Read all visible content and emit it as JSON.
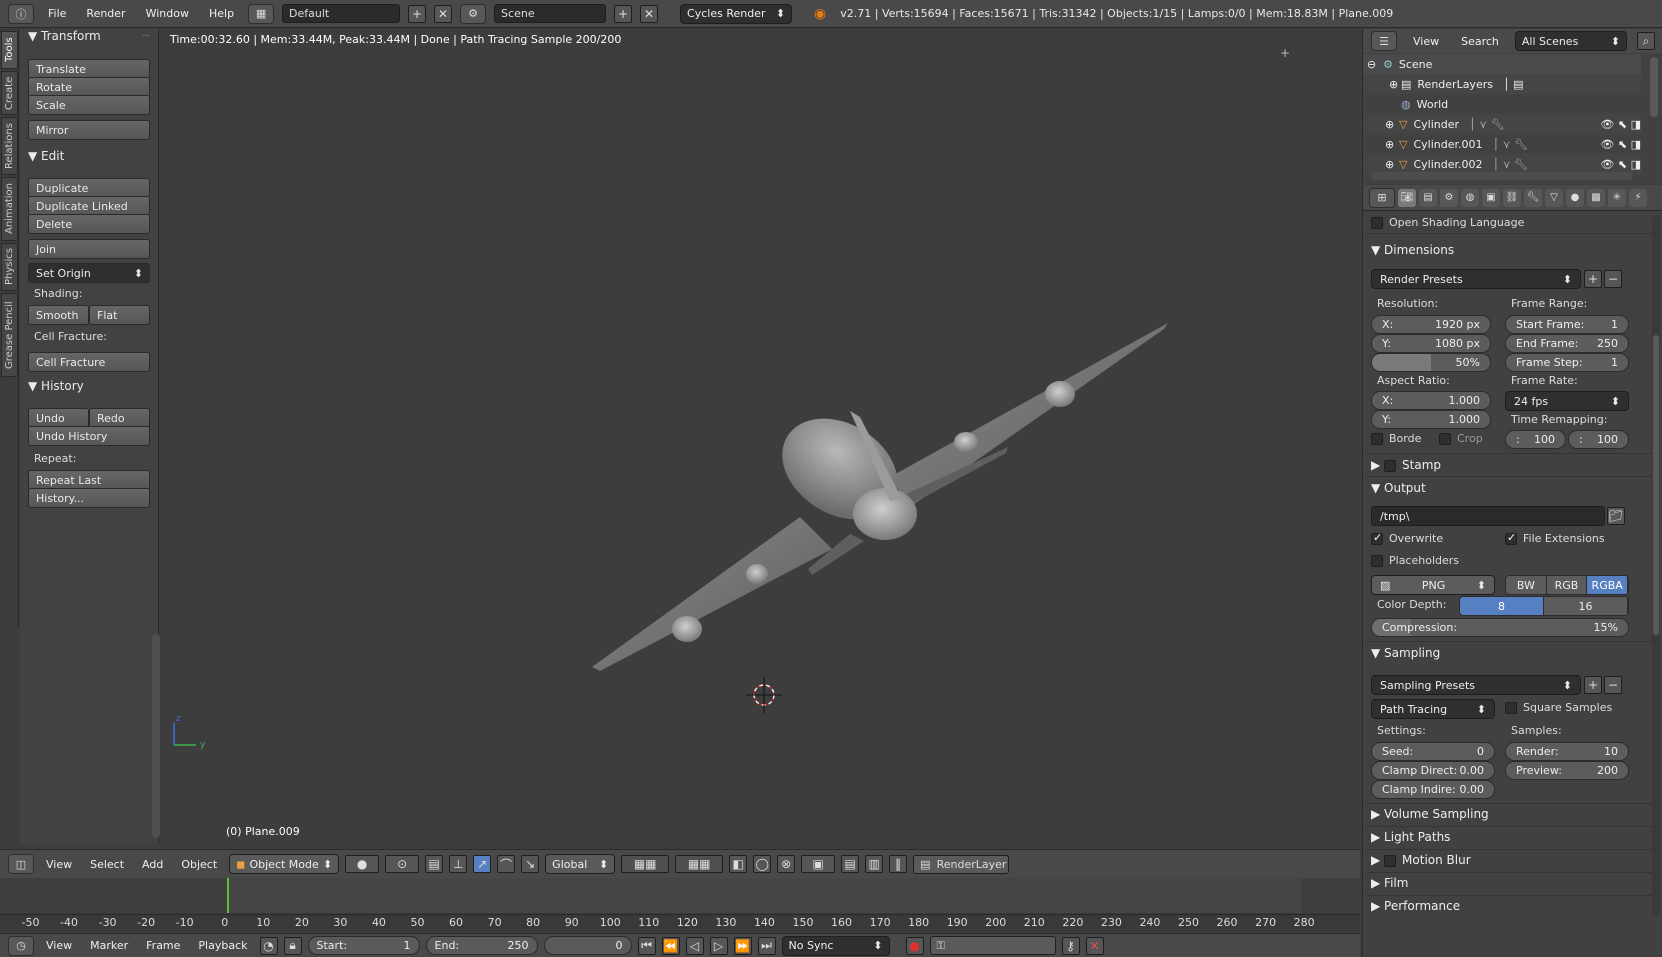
{
  "topbar": {
    "menus": [
      "File",
      "Render",
      "Window",
      "Help"
    ],
    "layout": "Default",
    "scene": "Scene",
    "engine": "Cycles Render",
    "stats": "v2.71 | Verts:15694 | Faces:15671 | Tris:31342 | Objects:1/15 | Lamps:0/0 | Mem:18.83M | Plane.009"
  },
  "lefttabs": [
    "Tools",
    "Create",
    "Relations",
    "Animation",
    "Physics",
    "Grease Pencil"
  ],
  "toolshelf": {
    "transform": {
      "title": "Transform",
      "buttons": [
        "Translate",
        "Rotate",
        "Scale",
        "Mirror"
      ]
    },
    "edit": {
      "title": "Edit",
      "buttons": [
        "Duplicate",
        "Duplicate Linked",
        "Delete",
        "Join"
      ],
      "set_origin": "Set Origin",
      "shading_label": "Shading:",
      "smooth": "Smooth",
      "flat": "Flat",
      "cell_fracture_label": "Cell Fracture:",
      "cell_fracture": "Cell Fracture"
    },
    "history": {
      "title": "History",
      "undo": "Undo",
      "redo": "Redo",
      "undo_history": "Undo History",
      "repeat_label": "Repeat:",
      "repeat_last": "Repeat Last",
      "history_btn": "History..."
    }
  },
  "viewport": {
    "info": "Time:00:32.60 | Mem:33.44M, Peak:33.44M | Done | Path Tracing Sample 200/200",
    "object_label": "(0) Plane.009",
    "axis_z": "z",
    "axis_y": "y"
  },
  "vpheader": {
    "menus": [
      "View",
      "Select",
      "Add",
      "Object"
    ],
    "mode": "Object Mode",
    "orientation": "Global",
    "render_layer": "RenderLayer"
  },
  "timeline": {
    "ticks": [
      "-50",
      "-40",
      "-30",
      "-20",
      "-10",
      "0",
      "10",
      "20",
      "30",
      "40",
      "50",
      "60",
      "70",
      "80",
      "90",
      "100",
      "110",
      "120",
      "130",
      "140",
      "150",
      "160",
      "170",
      "180",
      "190",
      "200",
      "210",
      "220",
      "230",
      "240",
      "250",
      "260",
      "270",
      "280"
    ],
    "current_frame": 0
  },
  "bottombar": {
    "menus": [
      "View",
      "Marker",
      "Frame",
      "Playback"
    ],
    "start_label": "Start:",
    "start": "1",
    "end_label": "End:",
    "end": "250",
    "current": "0",
    "sync": "No Sync"
  },
  "outliner": {
    "menus": [
      "View",
      "Search"
    ],
    "scenes": "All Scenes",
    "rows": [
      {
        "name": "Scene"
      },
      {
        "name": "RenderLayers"
      },
      {
        "name": "World"
      },
      {
        "name": "Cylinder"
      },
      {
        "name": "Cylinder.001"
      },
      {
        "name": "Cylinder.002"
      }
    ]
  },
  "props": {
    "osl": "Open Shading Language",
    "dimensions": {
      "title": "Dimensions",
      "presets": "Render Presets",
      "resolution_label": "Resolution:",
      "res_x_label": "X:",
      "res_x": "1920 px",
      "res_y_label": "Y:",
      "res_y": "1080 px",
      "res_pct": "50%",
      "aspect_label": "Aspect Ratio:",
      "asp_x_label": "X:",
      "asp_x": "1.000",
      "asp_y_label": "Y:",
      "asp_y": "1.000",
      "border": "Borde",
      "crop": "Crop",
      "frame_range_label": "Frame Range:",
      "start_label": "Start Frame:",
      "start": "1",
      "end_label": "End Frame:",
      "end": "250",
      "step_label": "Frame Step:",
      "step": "1",
      "frame_rate_label": "Frame Rate:",
      "frame_rate": "24 fps",
      "time_remap_label": "Time Remapping:",
      "remap_old": "100",
      "remap_new": "100"
    },
    "stamp": "Stamp",
    "output": {
      "title": "Output",
      "path": "/tmp\\",
      "overwrite": "Overwrite",
      "file_ext": "File Extensions",
      "placeholders": "Placeholders",
      "format": "PNG",
      "bw": "BW",
      "rgb": "RGB",
      "rgba": "RGBA",
      "color_depth_label": "Color Depth:",
      "depth_8": "8",
      "depth_16": "16",
      "compression_label": "Compression:",
      "compression": "15%"
    },
    "sampling": {
      "title": "Sampling",
      "presets": "Sampling Presets",
      "method": "Path Tracing",
      "square": "Square Samples",
      "settings_label": "Settings:",
      "seed_label": "Seed:",
      "seed": "0",
      "clamp_direct_label": "Clamp Direct:",
      "clamp_direct": "0.00",
      "clamp_indirect_label": "Clamp Indire:",
      "clamp_indirect": "0.00",
      "samples_label": "Samples:",
      "render_label": "Render:",
      "render": "10",
      "preview_label": "Preview:",
      "preview": "200"
    },
    "collapsed": [
      "Volume Sampling",
      "Light Paths",
      "Motion Blur",
      "Film",
      "Performance"
    ]
  },
  "colors": {
    "accent_blue": "#5680c2",
    "frame_marker": "#5fbf3a",
    "viewport": "#3d3d3d"
  }
}
